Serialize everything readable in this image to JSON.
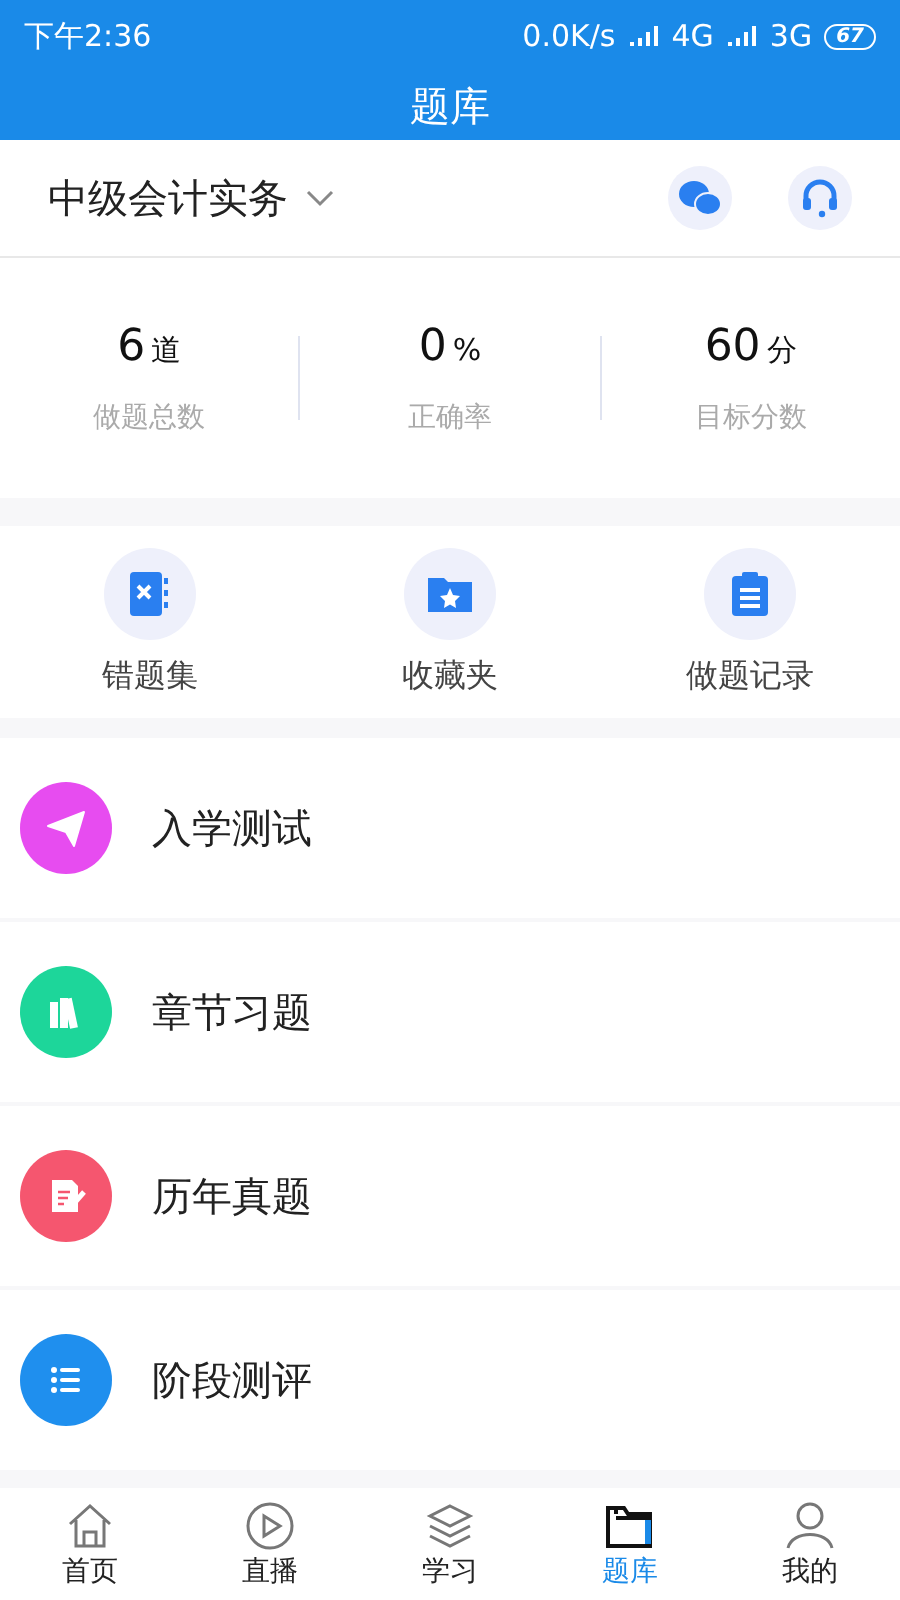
{
  "status_bar": {
    "time": "下午2:36",
    "speed": "0.0K/s",
    "network_1": "4G",
    "network_2": "3G",
    "battery": "67"
  },
  "title": "题库",
  "subject": {
    "name": "中级会计实务"
  },
  "stats": [
    {
      "value": "6",
      "unit": "道",
      "label": "做题总数"
    },
    {
      "value": "0",
      "unit": "%",
      "label": "正确率"
    },
    {
      "value": "60",
      "unit": "分",
      "label": "目标分数"
    }
  ],
  "shortcuts": [
    {
      "kind": "wrong",
      "label": "错题集"
    },
    {
      "kind": "favorite",
      "label": "收藏夹"
    },
    {
      "kind": "record",
      "label": "做题记录"
    }
  ],
  "sections": [
    {
      "kind": "plane",
      "label": "入学测试",
      "color": "#e74cf0"
    },
    {
      "kind": "books",
      "label": "章节习题",
      "color": "#1dd69a"
    },
    {
      "kind": "paper",
      "label": "历年真题",
      "color": "#f5566f"
    },
    {
      "kind": "list",
      "label": "阶段测评",
      "color": "#1f8fee"
    }
  ],
  "nav": [
    {
      "kind": "home",
      "label": "首页",
      "selected": false
    },
    {
      "kind": "play",
      "label": "直播",
      "selected": false
    },
    {
      "kind": "layers",
      "label": "学习",
      "selected": false
    },
    {
      "kind": "folder",
      "label": "题库",
      "selected": true
    },
    {
      "kind": "user",
      "label": "我的",
      "selected": false
    }
  ]
}
